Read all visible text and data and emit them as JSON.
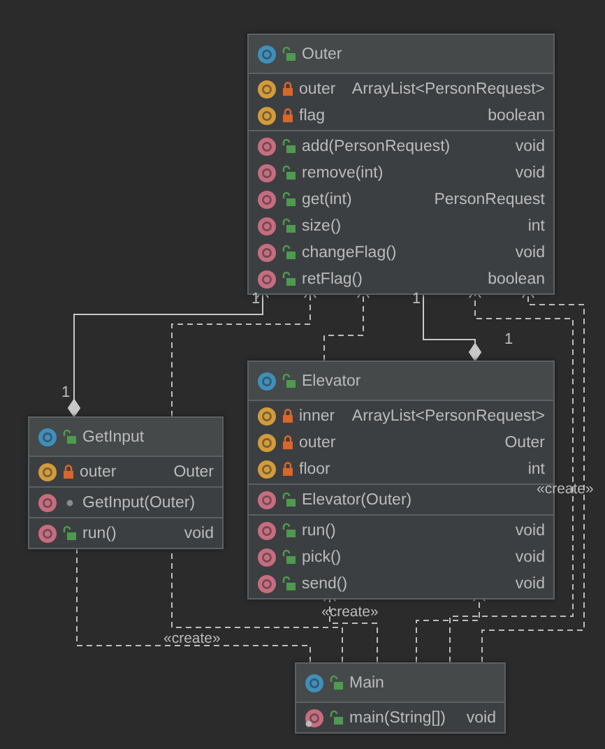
{
  "classes": [
    {
      "name": "Outer",
      "private": false,
      "package": false,
      "sections": [
        [
          {
            "kind": "field",
            "private": true,
            "package": false,
            "static": false,
            "name": "outer",
            "type": "ArrayList<PersonRequest>"
          },
          {
            "kind": "field",
            "private": true,
            "package": false,
            "static": false,
            "name": "flag",
            "type": "boolean"
          }
        ],
        [
          {
            "kind": "method",
            "private": false,
            "package": false,
            "static": false,
            "name": "add(PersonRequest)",
            "type": "void"
          },
          {
            "kind": "method",
            "private": false,
            "package": false,
            "static": false,
            "name": "remove(int)",
            "type": "void"
          },
          {
            "kind": "method",
            "private": false,
            "package": false,
            "static": false,
            "name": "get(int)",
            "type": "PersonRequest"
          },
          {
            "kind": "method",
            "private": false,
            "package": false,
            "static": false,
            "name": "size()",
            "type": "int"
          },
          {
            "kind": "method",
            "private": false,
            "package": false,
            "static": false,
            "name": "changeFlag()",
            "type": "void"
          },
          {
            "kind": "method",
            "private": false,
            "package": false,
            "static": false,
            "name": "retFlag()",
            "type": "boolean"
          }
        ]
      ]
    },
    {
      "name": "GetInput",
      "private": false,
      "package": false,
      "sections": [
        [
          {
            "kind": "field",
            "private": true,
            "package": false,
            "static": false,
            "name": "outer",
            "type": "Outer"
          }
        ],
        [
          {
            "kind": "method",
            "private": false,
            "package": true,
            "static": false,
            "name": "GetInput(Outer)"
          }
        ],
        [
          {
            "kind": "method",
            "private": false,
            "package": false,
            "static": false,
            "name": "run()",
            "type": "void"
          }
        ]
      ]
    },
    {
      "name": "Elevator",
      "private": false,
      "package": false,
      "sections": [
        [
          {
            "kind": "field",
            "private": true,
            "package": false,
            "static": false,
            "name": "inner",
            "type": "ArrayList<PersonRequest>"
          },
          {
            "kind": "field",
            "private": true,
            "package": false,
            "static": false,
            "name": "outer",
            "type": "Outer"
          },
          {
            "kind": "field",
            "private": true,
            "package": false,
            "static": false,
            "name": "floor",
            "type": "int"
          }
        ],
        [
          {
            "kind": "method",
            "private": false,
            "package": false,
            "static": false,
            "name": "Elevator(Outer)"
          }
        ],
        [
          {
            "kind": "method",
            "private": false,
            "package": false,
            "static": false,
            "name": "run()",
            "type": "void"
          },
          {
            "kind": "method",
            "private": false,
            "package": false,
            "static": false,
            "name": "pick()",
            "type": "void"
          },
          {
            "kind": "method",
            "private": false,
            "package": false,
            "static": false,
            "name": "send()",
            "type": "void"
          }
        ]
      ]
    },
    {
      "name": "Main",
      "private": false,
      "package": false,
      "sections": [
        [
          {
            "kind": "method",
            "private": false,
            "package": false,
            "static": true,
            "name": "main(String[])",
            "type": "void"
          }
        ]
      ]
    }
  ],
  "edge_labels": [
    {
      "kind": "multiplicity",
      "text": "1"
    },
    {
      "kind": "multiplicity",
      "text": "1"
    },
    {
      "kind": "multiplicity",
      "text": "1"
    },
    {
      "kind": "multiplicity",
      "text": "1"
    },
    {
      "kind": "stereotype",
      "text": "«create»"
    },
    {
      "kind": "stereotype",
      "text": "«create»"
    },
    {
      "kind": "stereotype",
      "text": "«create»"
    }
  ]
}
